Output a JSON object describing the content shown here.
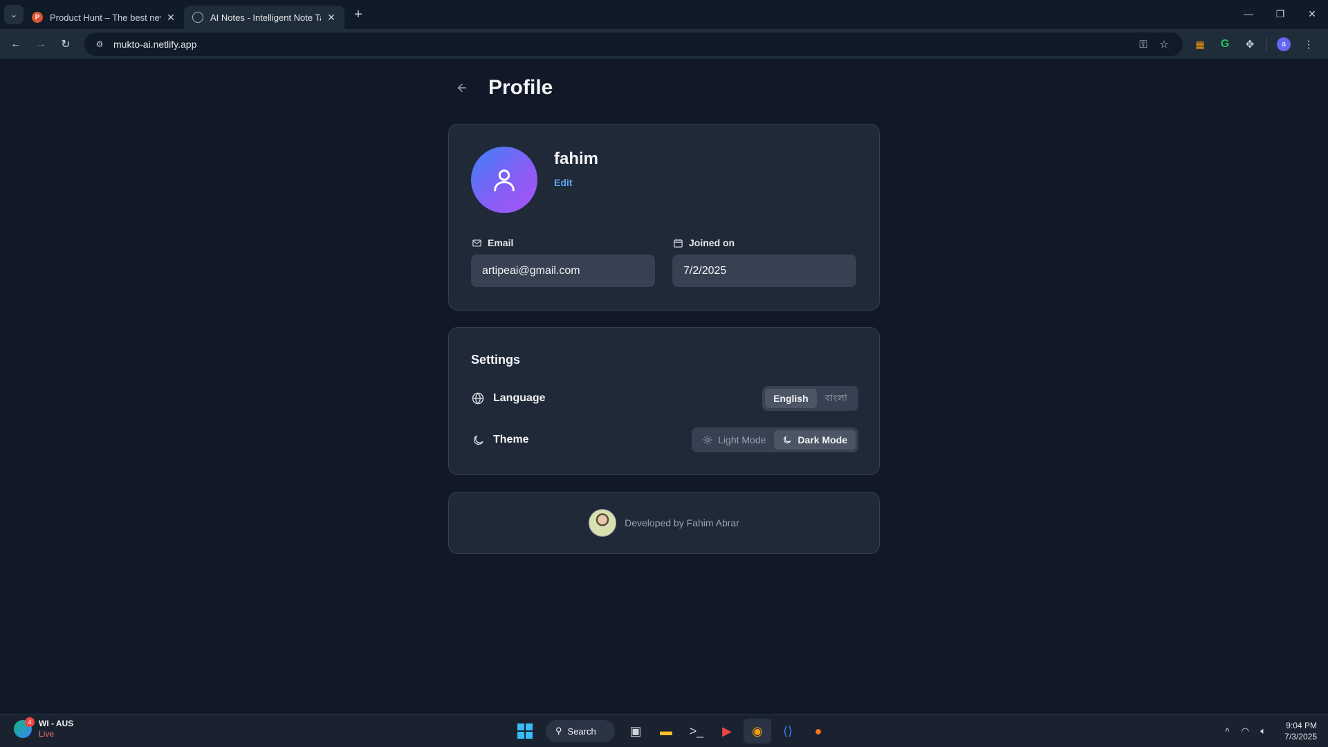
{
  "browser": {
    "tabs": [
      {
        "title": "Product Hunt – The best new p",
        "favicon": "product-hunt-icon",
        "favicon_letter": "P",
        "active": false
      },
      {
        "title": "AI Notes - Intelligent Note Taki",
        "favicon": "globe-icon",
        "active": true
      }
    ],
    "url": "mukto-ai.netlify.app",
    "profile_letter": "a"
  },
  "page": {
    "title": "Profile"
  },
  "profile": {
    "name": "fahim",
    "edit_label": "Edit",
    "email_label": "Email",
    "email_value": "artipeai@gmail.com",
    "joined_label": "Joined on",
    "joined_value": "7/2/2025"
  },
  "settings": {
    "title": "Settings",
    "language_label": "Language",
    "language_options": [
      "English",
      "বাংলা"
    ],
    "language_selected": "English",
    "theme_label": "Theme",
    "theme_options": [
      "Light Mode",
      "Dark Mode"
    ],
    "theme_selected": "Dark Mode"
  },
  "footer": {
    "developer_text": "Developed by Fahim Abrar"
  },
  "taskbar": {
    "weather_title": "WI - AUS",
    "weather_status": "Live",
    "weather_badge": "4",
    "search_label": "Search",
    "time": "9:04 PM",
    "date": "7/3/2025"
  },
  "colors": {
    "page_bg": "#111827",
    "card_bg": "#1f2937",
    "link": "#60a5fa",
    "avatar_gradient_start": "#3b82f6",
    "avatar_gradient_end": "#a855f7"
  }
}
